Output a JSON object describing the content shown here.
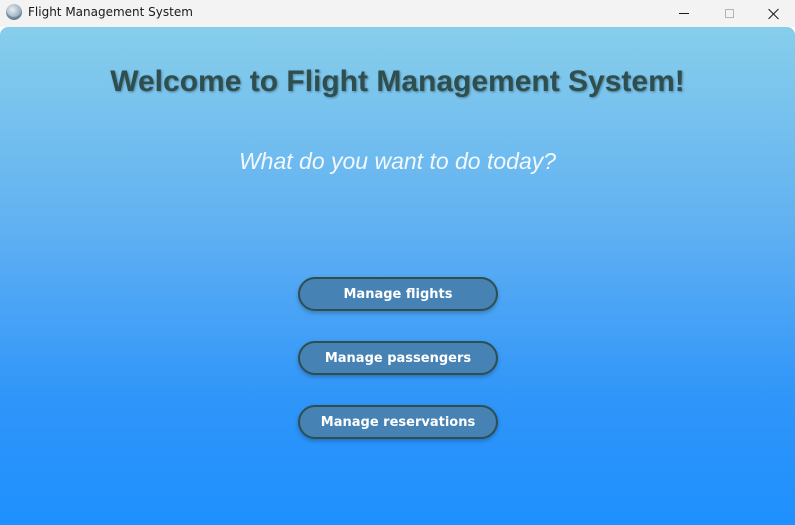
{
  "window": {
    "title": "Flight Management System",
    "icon": "app-globe-icon"
  },
  "controls": {
    "minimize_icon": "minimize-icon",
    "maximize_icon": "maximize-icon",
    "close_icon": "close-icon"
  },
  "main": {
    "heading": "Welcome to Flight Management System!",
    "subheading": "What do you want to do today?"
  },
  "actions": {
    "manage_flights": "Manage flights",
    "manage_passengers": "Manage passengers",
    "manage_reservations": "Manage reservations"
  },
  "colors": {
    "background_top": "#87ceeb",
    "background_bottom": "#1e90ff",
    "heading": "#2f4f4f",
    "button_fill": "#4682b4",
    "button_border": "#2f4f4f",
    "button_text": "#ffffff"
  }
}
